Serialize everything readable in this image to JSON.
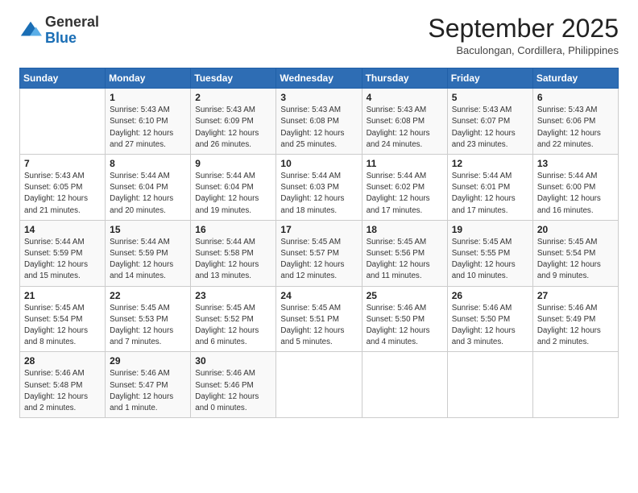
{
  "header": {
    "logo_general": "General",
    "logo_blue": "Blue",
    "month_title": "September 2025",
    "subtitle": "Baculongan, Cordillera, Philippines"
  },
  "days_of_week": [
    "Sunday",
    "Monday",
    "Tuesday",
    "Wednesday",
    "Thursday",
    "Friday",
    "Saturday"
  ],
  "weeks": [
    [
      {
        "day": "",
        "info": ""
      },
      {
        "day": "1",
        "info": "Sunrise: 5:43 AM\nSunset: 6:10 PM\nDaylight: 12 hours\nand 27 minutes."
      },
      {
        "day": "2",
        "info": "Sunrise: 5:43 AM\nSunset: 6:09 PM\nDaylight: 12 hours\nand 26 minutes."
      },
      {
        "day": "3",
        "info": "Sunrise: 5:43 AM\nSunset: 6:08 PM\nDaylight: 12 hours\nand 25 minutes."
      },
      {
        "day": "4",
        "info": "Sunrise: 5:43 AM\nSunset: 6:08 PM\nDaylight: 12 hours\nand 24 minutes."
      },
      {
        "day": "5",
        "info": "Sunrise: 5:43 AM\nSunset: 6:07 PM\nDaylight: 12 hours\nand 23 minutes."
      },
      {
        "day": "6",
        "info": "Sunrise: 5:43 AM\nSunset: 6:06 PM\nDaylight: 12 hours\nand 22 minutes."
      }
    ],
    [
      {
        "day": "7",
        "info": "Sunrise: 5:43 AM\nSunset: 6:05 PM\nDaylight: 12 hours\nand 21 minutes."
      },
      {
        "day": "8",
        "info": "Sunrise: 5:44 AM\nSunset: 6:04 PM\nDaylight: 12 hours\nand 20 minutes."
      },
      {
        "day": "9",
        "info": "Sunrise: 5:44 AM\nSunset: 6:04 PM\nDaylight: 12 hours\nand 19 minutes."
      },
      {
        "day": "10",
        "info": "Sunrise: 5:44 AM\nSunset: 6:03 PM\nDaylight: 12 hours\nand 18 minutes."
      },
      {
        "day": "11",
        "info": "Sunrise: 5:44 AM\nSunset: 6:02 PM\nDaylight: 12 hours\nand 17 minutes."
      },
      {
        "day": "12",
        "info": "Sunrise: 5:44 AM\nSunset: 6:01 PM\nDaylight: 12 hours\nand 17 minutes."
      },
      {
        "day": "13",
        "info": "Sunrise: 5:44 AM\nSunset: 6:00 PM\nDaylight: 12 hours\nand 16 minutes."
      }
    ],
    [
      {
        "day": "14",
        "info": "Sunrise: 5:44 AM\nSunset: 5:59 PM\nDaylight: 12 hours\nand 15 minutes."
      },
      {
        "day": "15",
        "info": "Sunrise: 5:44 AM\nSunset: 5:59 PM\nDaylight: 12 hours\nand 14 minutes."
      },
      {
        "day": "16",
        "info": "Sunrise: 5:44 AM\nSunset: 5:58 PM\nDaylight: 12 hours\nand 13 minutes."
      },
      {
        "day": "17",
        "info": "Sunrise: 5:45 AM\nSunset: 5:57 PM\nDaylight: 12 hours\nand 12 minutes."
      },
      {
        "day": "18",
        "info": "Sunrise: 5:45 AM\nSunset: 5:56 PM\nDaylight: 12 hours\nand 11 minutes."
      },
      {
        "day": "19",
        "info": "Sunrise: 5:45 AM\nSunset: 5:55 PM\nDaylight: 12 hours\nand 10 minutes."
      },
      {
        "day": "20",
        "info": "Sunrise: 5:45 AM\nSunset: 5:54 PM\nDaylight: 12 hours\nand 9 minutes."
      }
    ],
    [
      {
        "day": "21",
        "info": "Sunrise: 5:45 AM\nSunset: 5:54 PM\nDaylight: 12 hours\nand 8 minutes."
      },
      {
        "day": "22",
        "info": "Sunrise: 5:45 AM\nSunset: 5:53 PM\nDaylight: 12 hours\nand 7 minutes."
      },
      {
        "day": "23",
        "info": "Sunrise: 5:45 AM\nSunset: 5:52 PM\nDaylight: 12 hours\nand 6 minutes."
      },
      {
        "day": "24",
        "info": "Sunrise: 5:45 AM\nSunset: 5:51 PM\nDaylight: 12 hours\nand 5 minutes."
      },
      {
        "day": "25",
        "info": "Sunrise: 5:46 AM\nSunset: 5:50 PM\nDaylight: 12 hours\nand 4 minutes."
      },
      {
        "day": "26",
        "info": "Sunrise: 5:46 AM\nSunset: 5:50 PM\nDaylight: 12 hours\nand 3 minutes."
      },
      {
        "day": "27",
        "info": "Sunrise: 5:46 AM\nSunset: 5:49 PM\nDaylight: 12 hours\nand 2 minutes."
      }
    ],
    [
      {
        "day": "28",
        "info": "Sunrise: 5:46 AM\nSunset: 5:48 PM\nDaylight: 12 hours\nand 2 minutes."
      },
      {
        "day": "29",
        "info": "Sunrise: 5:46 AM\nSunset: 5:47 PM\nDaylight: 12 hours\nand 1 minute."
      },
      {
        "day": "30",
        "info": "Sunrise: 5:46 AM\nSunset: 5:46 PM\nDaylight: 12 hours\nand 0 minutes."
      },
      {
        "day": "",
        "info": ""
      },
      {
        "day": "",
        "info": ""
      },
      {
        "day": "",
        "info": ""
      },
      {
        "day": "",
        "info": ""
      }
    ]
  ]
}
